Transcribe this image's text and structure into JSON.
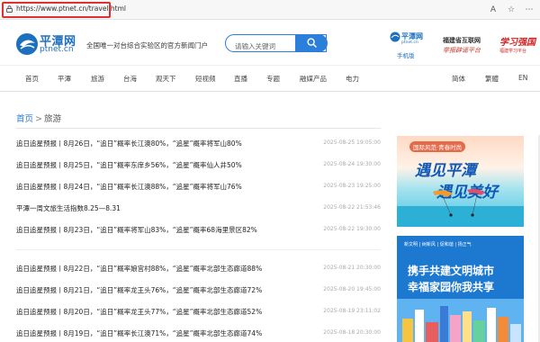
{
  "browser": {
    "url": "https://www.ptnet.cn/travel.html",
    "icons": [
      "A",
      "☆",
      "⋯"
    ]
  },
  "header": {
    "logo_cn": "平潭网",
    "logo_en": "ptnet.cn",
    "slogan": "全国唯一对台综合实验区的官方新闻门户",
    "search_placeholder": "请输入关键词",
    "mobile_cn": "平潭网",
    "mobile_en": "ptnet.cn",
    "mobile_label": "手机版",
    "fj_line1": "福建省互联网",
    "fj_line2": "举报辟谣平台",
    "xx_line1": "学习强国",
    "xx_line2": "福建学习平台"
  },
  "nav": {
    "items": [
      {
        "label": "首页"
      },
      {
        "label": "平潭"
      },
      {
        "label": "旅游"
      },
      {
        "label": "台海"
      },
      {
        "label": "观天下"
      },
      {
        "label": "短视频"
      },
      {
        "label": "直播"
      },
      {
        "label": "专题"
      },
      {
        "label": "融媒产品"
      },
      {
        "label": "电力"
      }
    ],
    "right": [
      {
        "label": "简体"
      },
      {
        "label": "繁體"
      },
      {
        "label": "EN"
      }
    ]
  },
  "breadcrumb": {
    "home": "首页",
    "sep": ">",
    "current": "旅游"
  },
  "news": [
    {
      "title": "追日追星预报丨8月26日，“追日”概率长江澳80%，“追星”概率将军山80%",
      "date": "2025-08-25 19:05:00"
    },
    {
      "title": "追日追星预报丨8月25日，“追日”概率东庠乡56%，“追星”概率仙人井50%",
      "date": "2025-08-24 19:30:00"
    },
    {
      "title": "追日追星预报丨8月24日，“追日”概率长江澳88%，“追星”概率将军山76%",
      "date": "2025-08-23 19:25:00"
    },
    {
      "title": "平潭一周文旅生活指数8.25—8.31",
      "date": "2025-08-22 21:53:46"
    },
    {
      "title": "追日追星预报丨8月23日，“追日”概率将军山83%，“追星”概率68海里景区82%",
      "date": "2025-08-22 19:30:00"
    },
    {
      "title": "追日追星预报丨8月22日，“追日”概率娘宫村88%，“追星”概率北部生态廊道88%",
      "date": "2025-08-21 20:30:00"
    },
    {
      "title": "追日追星预报丨8月21日，“追日”概率龙王头76%，“追星”概率北部生态廊道72%",
      "date": "2025-08-20 19:45:00"
    },
    {
      "title": "追日追星预报丨8月20日，“追日”概率龙王头77%，“追星”概率北部生态廊道52%",
      "date": "2025-08-19 23:11:02"
    },
    {
      "title": "追日追星预报丨8月19日，“追日”概率长江澳71%，“追星”概率北部生态廊道74%",
      "date": "2025-08-18 20:30:00"
    }
  ],
  "ads": {
    "ad1_tag": "国际风范·青春时尚",
    "ad1_line1": "遇见平潭",
    "ad1_line2": "遇见美好",
    "ad2_strip": "新文明 | 树新风 | 促和谐 | 扬正气",
    "ad2_line1": "携手共建文明城市",
    "ad2_line2": "幸福家园你我共享"
  },
  "colors": {
    "accent": "#2b7ed9",
    "highlight": "#e03131"
  }
}
